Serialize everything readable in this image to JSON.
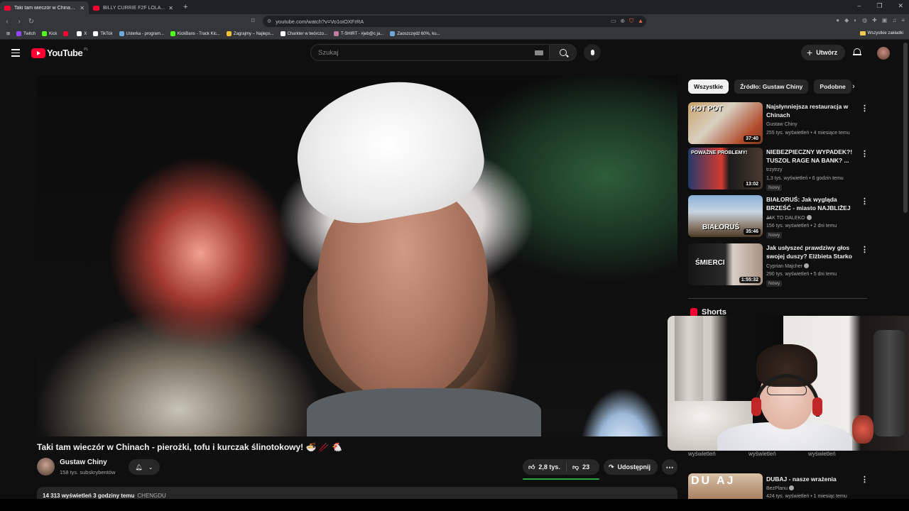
{
  "browser": {
    "tabs": [
      {
        "title": "Taki tam wieczór w Chinach - ",
        "active": true
      },
      {
        "title": "BILLY CURRIE F2F LOLA VOSS | FACE",
        "active": false
      }
    ],
    "new_tab": "+",
    "window_controls": [
      "–",
      "❐",
      "✕"
    ],
    "url": "youtube.com/watch?v=Vo1oiOXFrRA",
    "bookmarks": [
      {
        "label": "Twitch",
        "color": "#9146ff"
      },
      {
        "label": "Kick",
        "color": "#53fc18"
      },
      {
        "label": "",
        "color": "#ff0033"
      },
      {
        "label": "X",
        "color": "#ffffff"
      },
      {
        "label": "TikTok",
        "color": "#ffffff"
      },
      {
        "label": "Usterka - program...",
        "color": "#6fa8dc"
      },
      {
        "label": "KickBans - Track Kic...",
        "color": "#53fc18"
      },
      {
        "label": "Zagrajmy – Najleps...",
        "color": "#f1c232"
      },
      {
        "label": "Charkter w twórczo...",
        "color": "#ffffff"
      },
      {
        "label": "T-SHIRT - #jeb@c ja...",
        "color": "#c27ba0"
      },
      {
        "label": "Zaoszczędź 60%, ku...",
        "color": "#6fa8dc"
      }
    ],
    "all_bookmarks": "Wszystkie zakładki"
  },
  "header": {
    "logo": "YouTube",
    "country": "PL",
    "search_placeholder": "Szukaj",
    "create_label": "Utwórz"
  },
  "video": {
    "title": "Taki tam wieczór w Chinach - pierożki, tofu i kurczak ślinotokowy! 🍜 🥢 🐔",
    "channel": "Gustaw Chiny",
    "subscribers": "158 tys. subskrybentów",
    "likes": "2,8 tys.",
    "dislikes": "23",
    "share_label": "Udostępnij",
    "more": "⋯",
    "description_stats": "14 313 wyświetleń  3 godziny temu",
    "description_tag": "CHENGDU"
  },
  "chips": [
    "Wszystkie",
    "Źródło: Gustaw Chiny",
    "Podobne"
  ],
  "recommendations": [
    {
      "title": "Najsłynniejsza restauracja w Chinach",
      "channel": "Gustaw Chiny",
      "meta": "255 tys. wyświetleń • 4 miesiące temu",
      "duration": "37:40",
      "thumb_text": "HOT     POT",
      "badge": "",
      "verified": false
    },
    {
      "title": "NIEBEZPIECZNY WYPADEK?! TUSZOL RAGE NA BANK? ...",
      "channel": "trzytrzy",
      "meta": "1,3 tys. wyświetleń • 6 godzin temu",
      "duration": "13:02",
      "thumb_text": "POWAŻNE PROBLEMY!",
      "badge": "Nowy",
      "verified": false
    },
    {
      "title": "BIAŁORUŚ: Jak wygląda BRZEŚĆ - miasto NAJBLIŻEJ ...",
      "channel": "JAK TO DALEKO",
      "meta": "156 tys. wyświetleń • 2 dni temu",
      "duration": "35:46",
      "thumb_text": "BIAŁORUŚ",
      "badge": "Nowy",
      "verified": true
    },
    {
      "title": "Jak usłyszeć prawdziwy głos swojej duszy? Elżbieta Starko",
      "channel": "Cyprian Majcher",
      "meta": "290 tys. wyświetleń • 5 dni temu",
      "duration": "1:55:32",
      "thumb_text": "ŚMIERCI",
      "badge": "Nowy",
      "verified": true
    }
  ],
  "shorts": {
    "heading": "Shorts",
    "labels": [
      "wyświetleń",
      "wyświetleń",
      "wyświetleń"
    ]
  },
  "bottom_rec": {
    "title": "DUBAJ - nasze wrażenia",
    "channel": "BezPlanu",
    "meta": "424 tys. wyświetleń • 1 miesiąc temu",
    "thumb_text": "DU  AJ"
  },
  "colors": {
    "background": "#0f0f0f",
    "accent_red": "#ff0033",
    "like_bar": "#2ba640",
    "pill": "#272727"
  }
}
